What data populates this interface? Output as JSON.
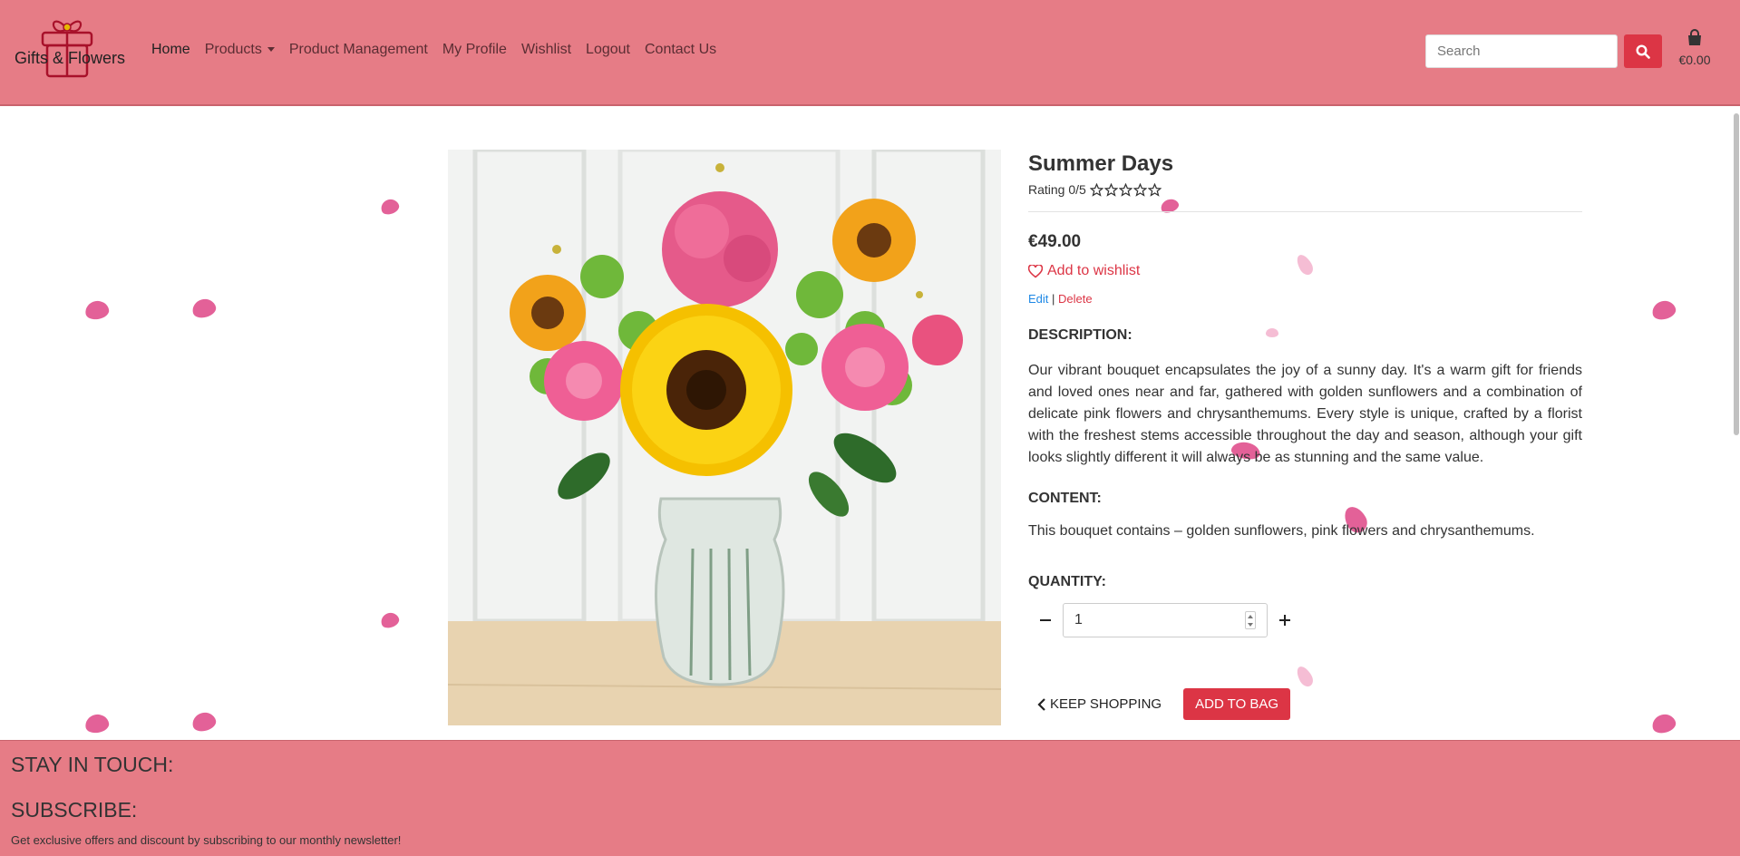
{
  "header": {
    "logo_text": "Gifts & Flowers",
    "nav": [
      {
        "label": "Home"
      },
      {
        "label": "Products"
      },
      {
        "label": "Product Management"
      },
      {
        "label": "My Profile"
      },
      {
        "label": "Wishlist"
      },
      {
        "label": "Logout"
      },
      {
        "label": "Contact Us"
      }
    ],
    "search_placeholder": "Search",
    "bag_total": "€0.00"
  },
  "product": {
    "title": "Summer Days",
    "rating_label": "Rating 0/5",
    "rating_value": 0,
    "rating_max": 5,
    "price": "€49.00",
    "wishlist_label": "Add to wishlist",
    "edit_label": "Edit",
    "separator": "|",
    "delete_label": "Delete",
    "description_heading": "DESCRIPTION:",
    "description": "Our vibrant bouquet encapsulates the joy of a sunny day. It's a warm gift for friends and loved ones near and far, gathered with golden sunflowers and a combination of delicate pink flowers and chrysanthemums. Every style is unique, crafted by a florist with the freshest stems accessible throughout the day and season, although your gift looks slightly different it will always be as stunning and the same value.",
    "content_heading": "CONTENT:",
    "content": "This bouquet contains – golden sunflowers, pink flowers and chrysanthemums.",
    "quantity_heading": "QUANTITY:",
    "quantity": "1",
    "keep_shopping_label": "KEEP SHOPPING",
    "add_to_bag_label": "ADD TO BAG"
  },
  "footer": {
    "stay_in_touch": "STAY IN TOUCH:",
    "subscribe": "SUBSCRIBE:",
    "newsletter_note": "Get exclusive offers and discount by subscribing to our monthly newsletter!"
  },
  "colors": {
    "header_bg": "#e67c86",
    "accent": "#dc3545",
    "petal": "#e0508d",
    "link_blue": "#1e88e5"
  }
}
